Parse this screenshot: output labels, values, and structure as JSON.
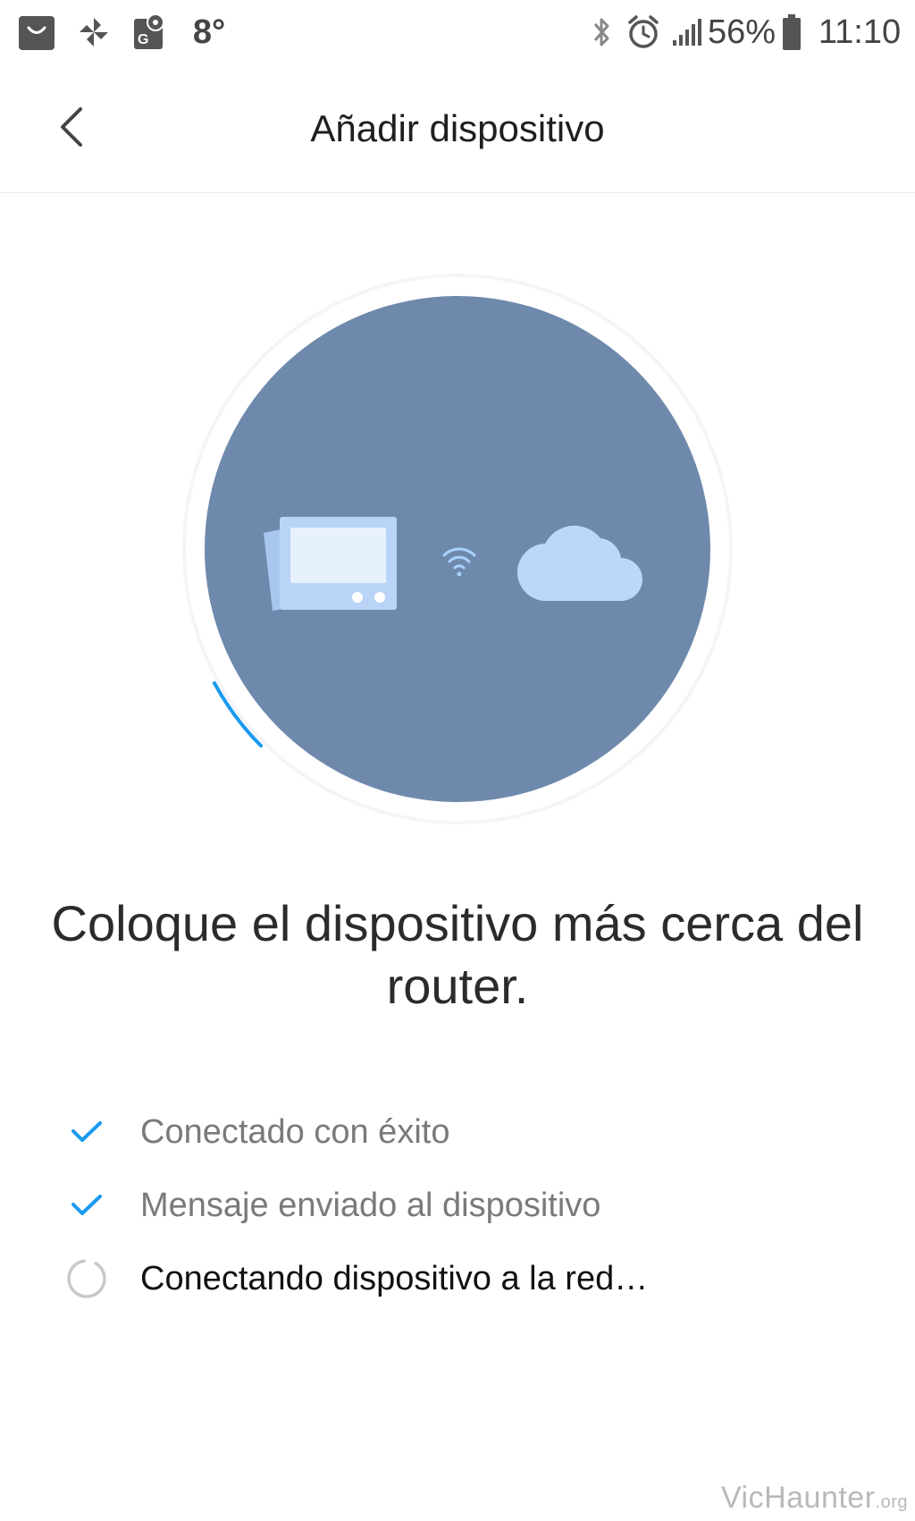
{
  "status_bar": {
    "temperature": "8°",
    "battery_percent": "56%",
    "time": "11:10",
    "left_icons": [
      "shopping-bag-icon",
      "pinwheel-icon",
      "maps-icon"
    ],
    "right_icons": [
      "bluetooth-icon",
      "alarm-icon",
      "signal-icon",
      "battery-icon"
    ]
  },
  "header": {
    "title": "Añadir dispositivo",
    "back_icon": "chevron-left-icon"
  },
  "illustration": {
    "circle_color": "#6f89ac",
    "progress_color": "#1a9af0",
    "icons": [
      "device-icon",
      "wifi-icon",
      "cloud-icon"
    ]
  },
  "headline": "Coloque el dispositivo más cerca del router.",
  "steps": [
    {
      "label": "Conectado con éxito",
      "state": "done",
      "icon": "checkmark-icon"
    },
    {
      "label": "Mensaje enviado al dispositivo",
      "state": "done",
      "icon": "checkmark-icon"
    },
    {
      "label": "Conectando dispositivo a la red…",
      "state": "in-progress",
      "icon": "spinner-icon"
    }
  ],
  "watermark": {
    "name": "VicHaunter",
    "tld": ".org"
  },
  "colors": {
    "check": "#1a9af0",
    "spinner": "#c9c9c9"
  }
}
